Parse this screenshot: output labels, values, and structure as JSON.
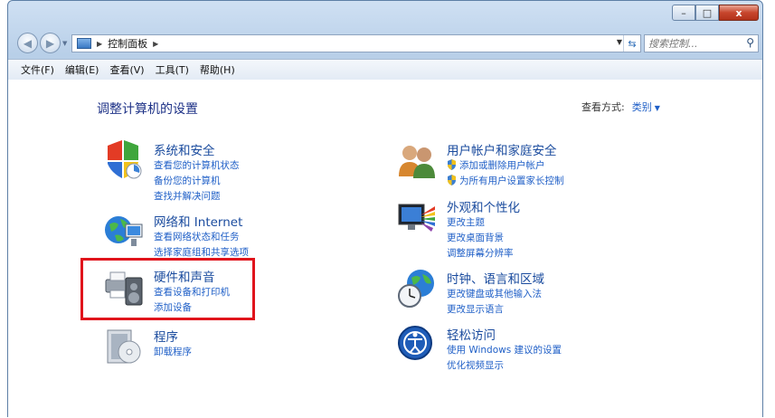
{
  "window": {
    "caption_buttons": {
      "minimize": "–",
      "maximize": "□",
      "close": "x"
    }
  },
  "nav": {
    "back_icon": "back-arrow-icon",
    "forward_icon": "forward-arrow-icon",
    "address_path": "控制面板",
    "search_placeholder": "搜索控制..."
  },
  "menu": [
    "文件(F)",
    "编辑(E)",
    "查看(V)",
    "工具(T)",
    "帮助(H)"
  ],
  "main": {
    "heading": "调整计算机的设置",
    "view_mode_label": "查看方式:",
    "view_mode_value": "类别"
  },
  "categories": [
    {
      "icon": "security-shield-icon",
      "title": "系统和安全",
      "links": [
        {
          "text": "查看您的计算机状态",
          "shield": false
        },
        {
          "text": "备份您的计算机",
          "shield": false
        },
        {
          "text": "查找并解决问题",
          "shield": false
        }
      ]
    },
    {
      "icon": "network-globe-icon",
      "title": "网络和 Internet",
      "links": [
        {
          "text": "查看网络状态和任务",
          "shield": false
        },
        {
          "text": "选择家庭组和共享选项",
          "shield": false
        }
      ]
    },
    {
      "icon": "printer-speaker-icon",
      "title": "硬件和声音",
      "links": [
        {
          "text": "查看设备和打印机",
          "shield": false
        },
        {
          "text": "添加设备",
          "shield": false
        }
      ]
    },
    {
      "icon": "programs-disc-icon",
      "title": "程序",
      "links": [
        {
          "text": "卸载程序",
          "shield": false
        }
      ]
    },
    {
      "icon": "users-icon",
      "title": "用户帐户和家庭安全",
      "links": [
        {
          "text": "添加或删除用户帐户",
          "shield": true
        },
        {
          "text": "为所有用户设置家长控制",
          "shield": true
        }
      ]
    },
    {
      "icon": "appearance-monitor-icon",
      "title": "外观和个性化",
      "links": [
        {
          "text": "更改主题",
          "shield": false
        },
        {
          "text": "更改桌面背景",
          "shield": false
        },
        {
          "text": "调整屏幕分辨率",
          "shield": false
        }
      ]
    },
    {
      "icon": "clock-globe-icon",
      "title": "时钟、语言和区域",
      "links": [
        {
          "text": "更改键盘或其他输入法",
          "shield": false
        },
        {
          "text": "更改显示语言",
          "shield": false
        }
      ]
    },
    {
      "icon": "ease-of-access-icon",
      "title": "轻松访问",
      "links": [
        {
          "text": "使用 Windows 建议的设置",
          "shield": false
        },
        {
          "text": "优化视频显示",
          "shield": false
        }
      ]
    }
  ],
  "colors": {
    "highlight": "#e0141c",
    "link": "#1f5fc7",
    "title": "#1a4b9e"
  }
}
